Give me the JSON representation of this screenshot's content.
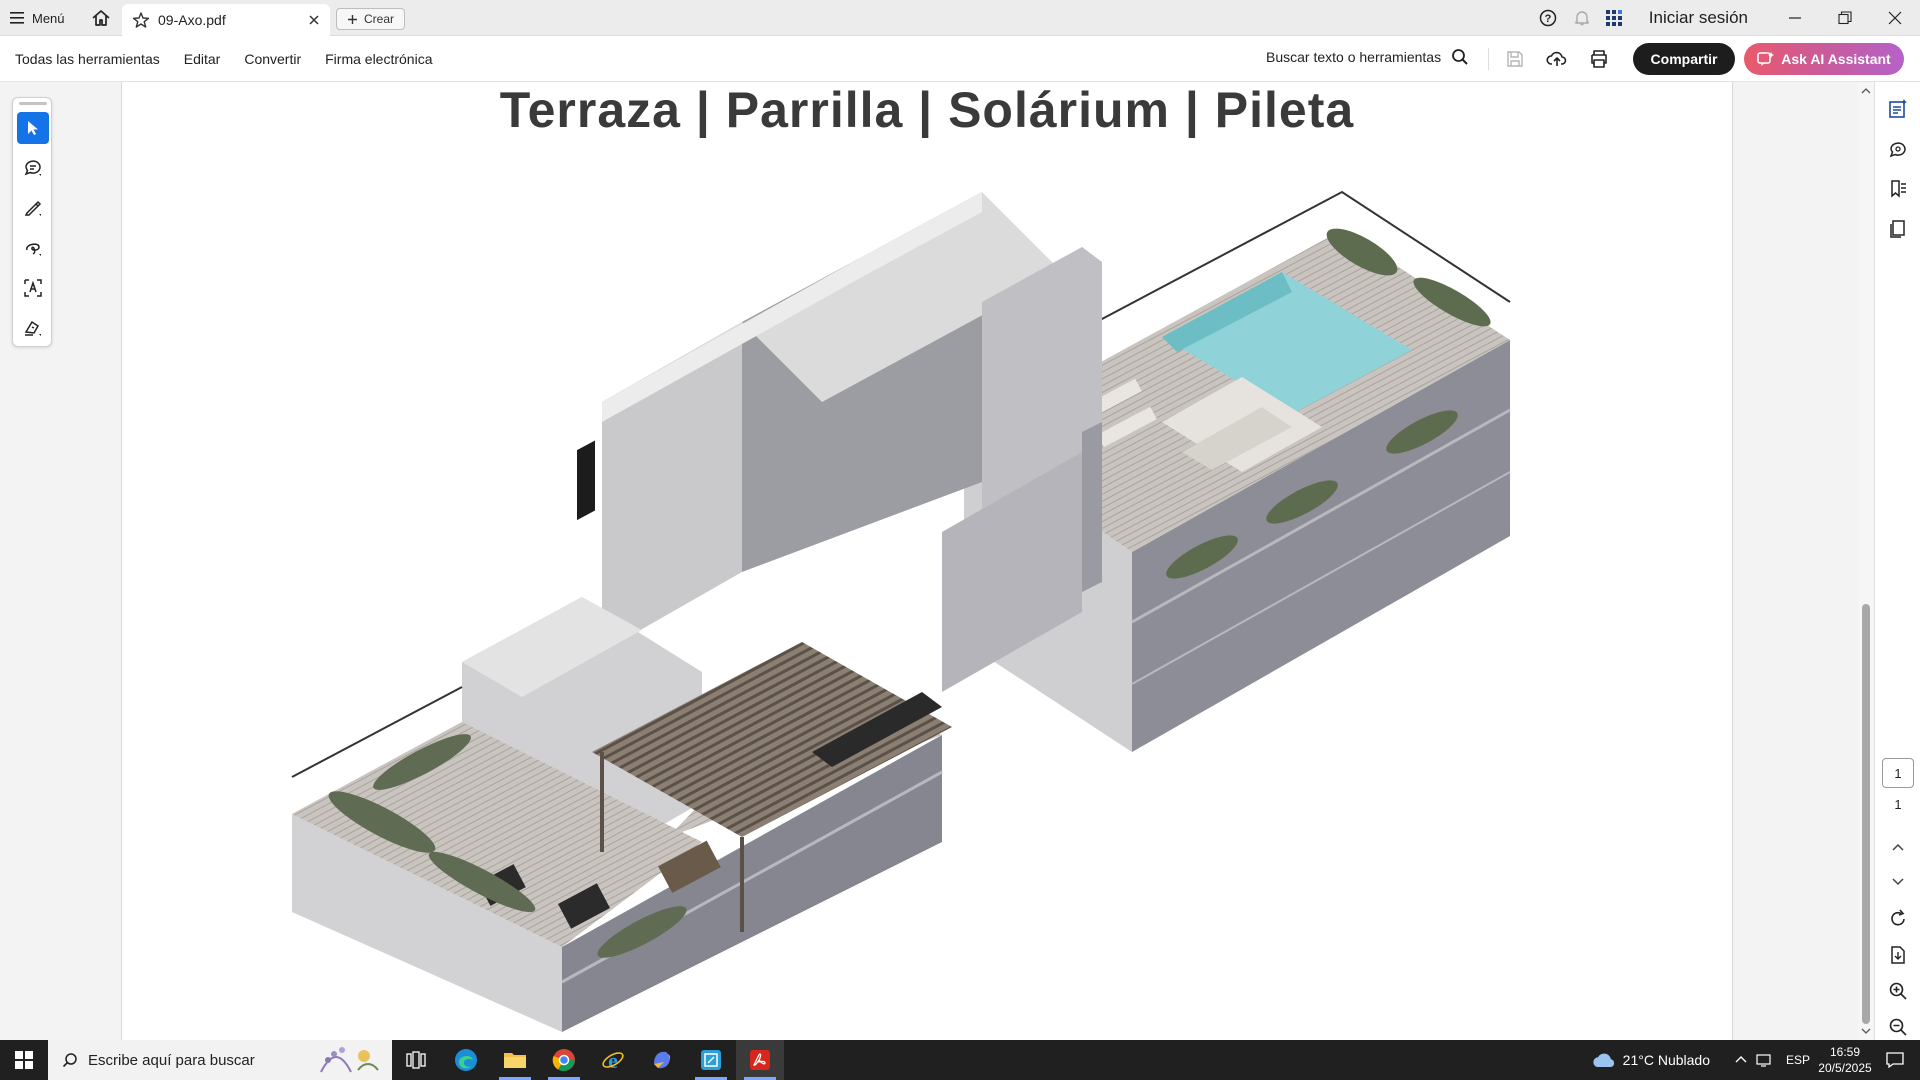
{
  "titlebar": {
    "menu_label": "Menú",
    "tab_title": "09-Axo.pdf",
    "create_label": "Crear",
    "signin_label": "Iniciar sesión"
  },
  "toolbar": {
    "items": [
      "Todas las herramientas",
      "Editar",
      "Convertir",
      "Firma electrónica"
    ],
    "search_label": "Buscar texto o herramientas",
    "share_label": "Compartir",
    "ai_label": "Ask AI Assistant"
  },
  "document": {
    "title": "Terraza | Parrilla | Solárium | Pileta"
  },
  "pager": {
    "current_page": "1",
    "total_pages": "1"
  },
  "taskbar": {
    "search_placeholder": "Escribe aquí para buscar",
    "weather": "21°C  Nublado",
    "language": "ESP",
    "time": "16:59",
    "date": "20/5/2025"
  },
  "colors": {
    "accent_blue": "#1473e6",
    "share_button": "#1d1d1d",
    "ai_gradient_start": "#ea5a6a",
    "ai_gradient_end": "#b562c8",
    "pool_water": "#8fd3d8"
  }
}
